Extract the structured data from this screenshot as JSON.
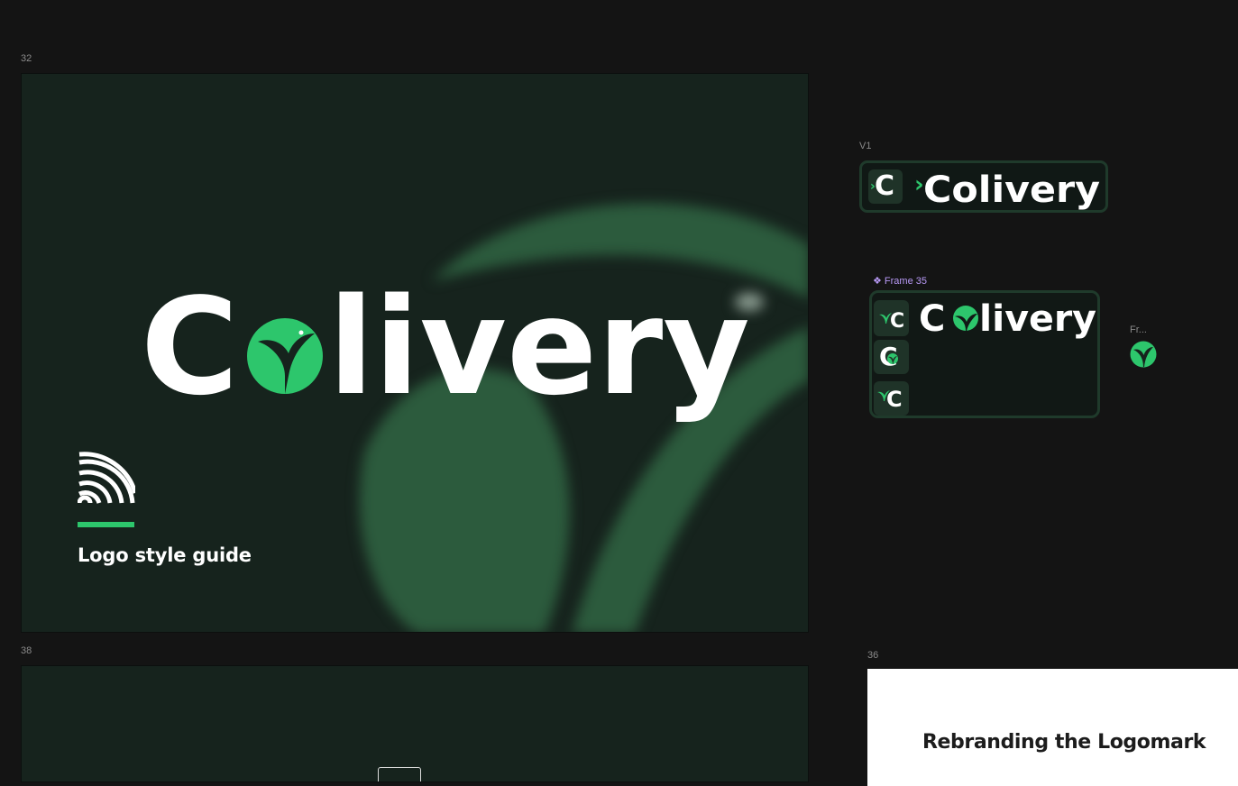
{
  "frames": {
    "f32": {
      "label": "32",
      "wordmark_left": "C",
      "wordmark_right": "livery",
      "title": "Logo style guide"
    },
    "f38": {
      "label": "38"
    },
    "v1": {
      "label": "V1",
      "tile_letter": "C",
      "wordmark": "Colivery"
    },
    "f35": {
      "label": "❖ Frame 35",
      "tile_letter": "C",
      "wordmark_left": "C",
      "wordmark_right": "livery"
    },
    "fr": {
      "label": "Fr..."
    },
    "f36": {
      "label": "36",
      "title": "Rebranding the Logomark"
    }
  },
  "colors": {
    "canvas_bg": "#141414",
    "frame_dark_green": "#16231d",
    "brand_green": "#2dc66c",
    "component_purple": "#b99af7",
    "white": "#ffffff"
  },
  "icons": [
    "leaf-bird-icon",
    "concentric-arcs-icon",
    "chevron-icon"
  ]
}
